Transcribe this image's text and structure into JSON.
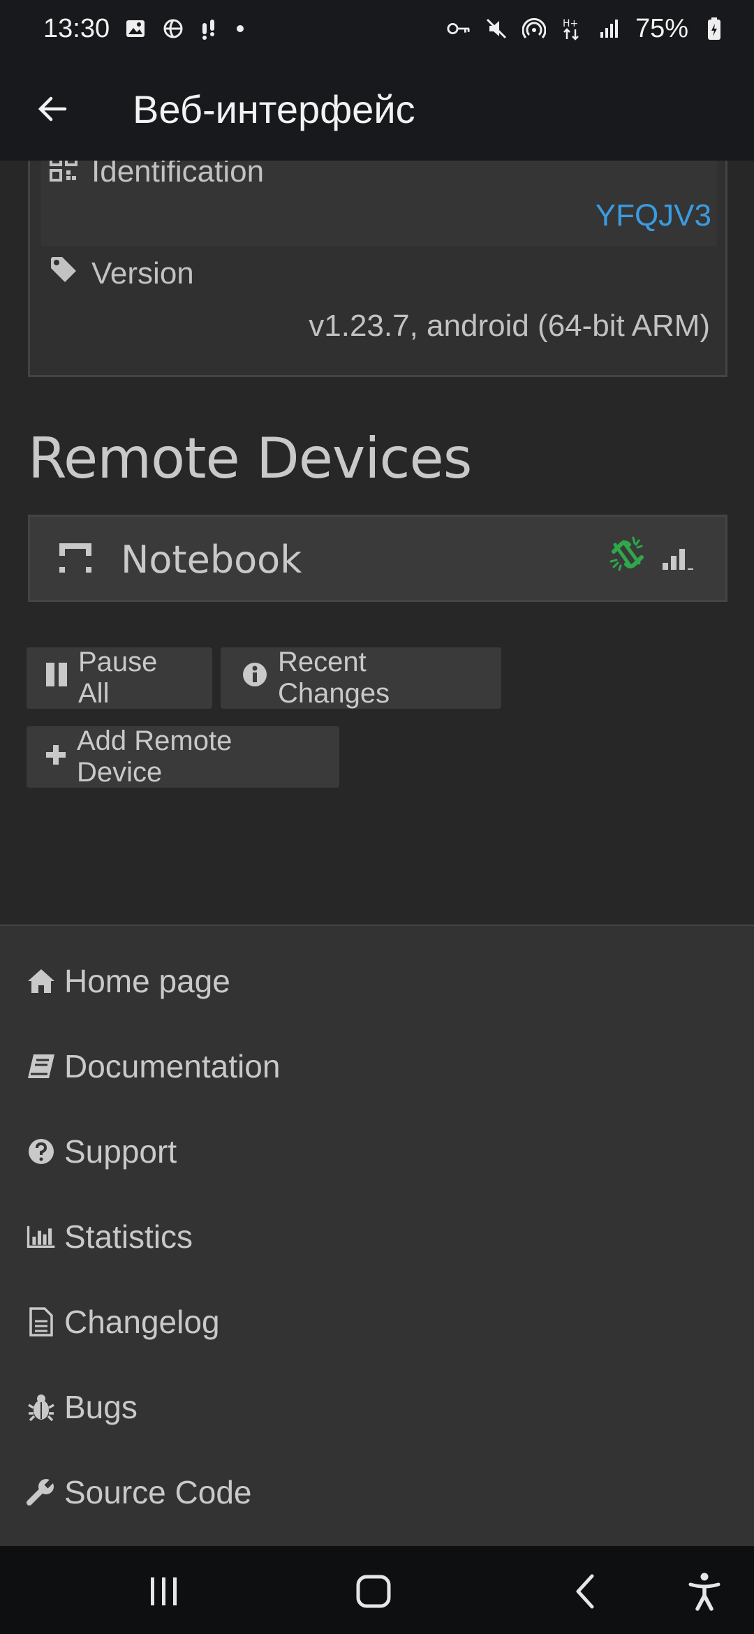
{
  "status_bar": {
    "time": "13:30",
    "battery": "75%",
    "left_icons": [
      "image-icon",
      "vpn-globe-icon",
      "notification-icon"
    ],
    "right_icons": [
      "key-icon",
      "mute-icon",
      "hotspot-icon",
      "data-icon",
      "signal-icon",
      "battery-icon"
    ]
  },
  "app_bar": {
    "title": "Веб-интерфейс"
  },
  "this_device": {
    "identification_label": "Identification",
    "identification_value": "YFQJV3",
    "version_label": "Version",
    "version_value": "v1.23.7, android (64-bit ARM)"
  },
  "remote_devices": {
    "title": "Remote Devices",
    "devices": [
      {
        "name": "Notebook",
        "status_color": "#2ea84a"
      }
    ],
    "buttons": {
      "pause_all": "Pause All",
      "recent_changes": "Recent Changes",
      "add_remote_device": "Add Remote Device"
    }
  },
  "footer": {
    "links": [
      {
        "label": "Home page",
        "icon": "home-icon"
      },
      {
        "label": "Documentation",
        "icon": "book-icon"
      },
      {
        "label": "Support",
        "icon": "question-circle-icon"
      },
      {
        "label": "Statistics",
        "icon": "bar-chart-icon"
      },
      {
        "label": "Changelog",
        "icon": "file-text-icon"
      },
      {
        "label": "Bugs",
        "icon": "bug-icon"
      },
      {
        "label": "Source Code",
        "icon": "wrench-icon"
      }
    ]
  },
  "colors": {
    "accent_link": "#3a9ce0",
    "connected_green": "#2ea84a",
    "background": "#272727",
    "panel": "#303030",
    "bars": "#17191c"
  }
}
